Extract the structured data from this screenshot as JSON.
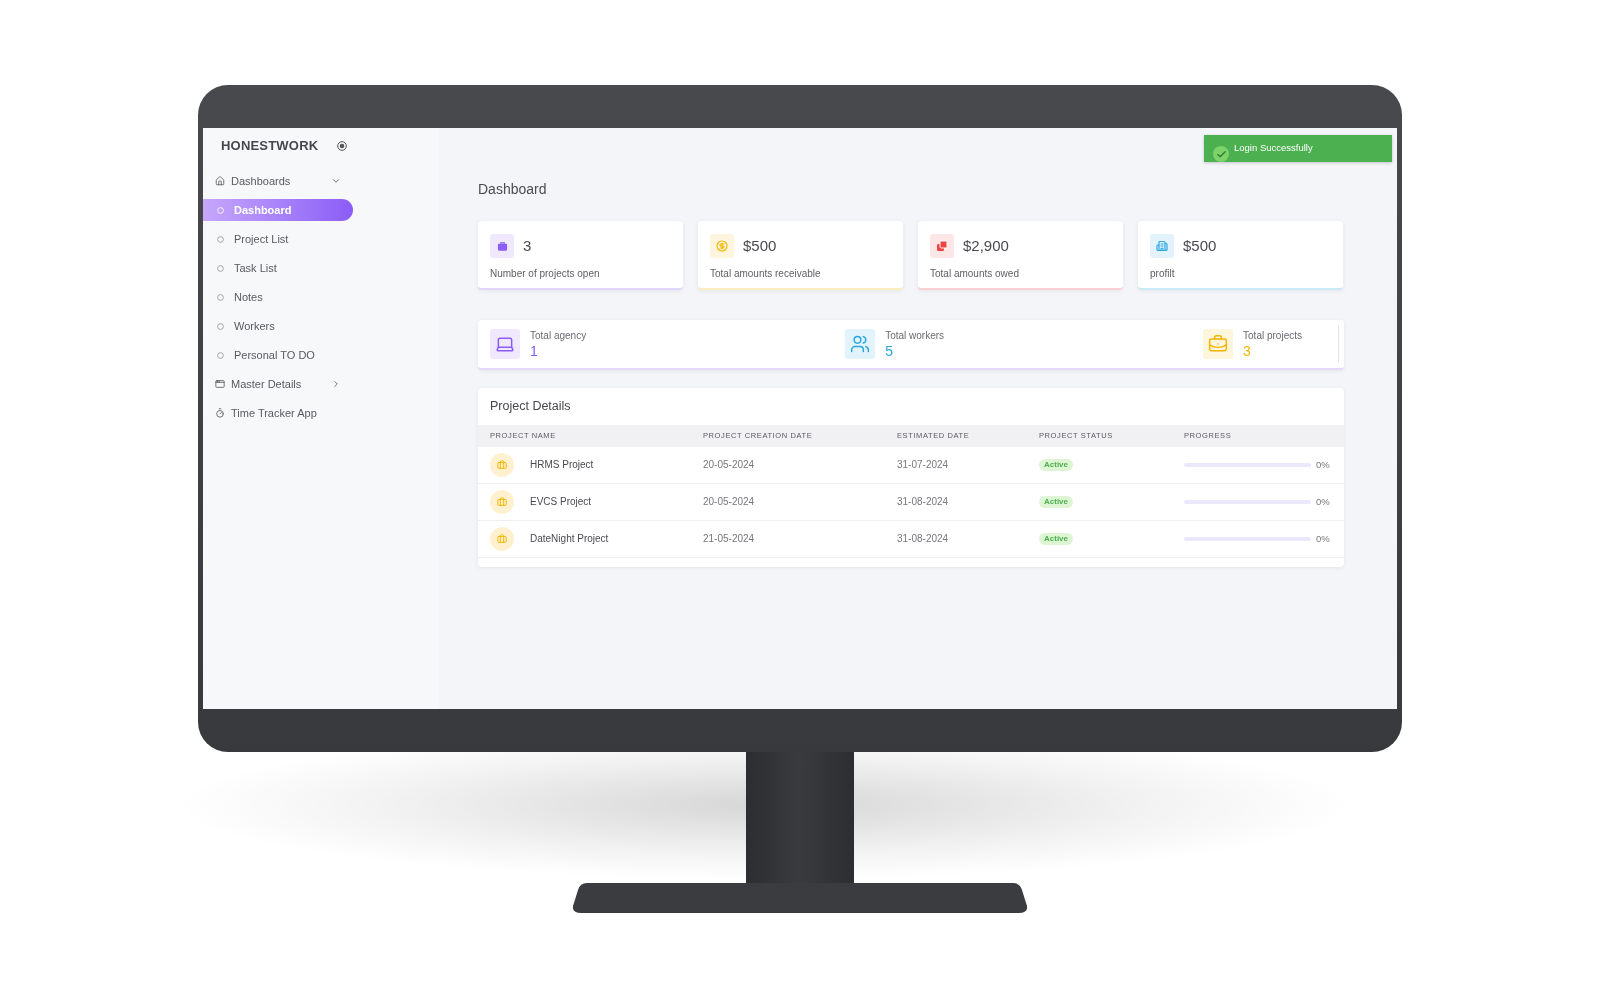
{
  "brand": {
    "name": "HONESTWORK"
  },
  "sidebar": {
    "items": [
      {
        "label": "Dashboards",
        "kind": "group",
        "expanded": true,
        "selected": false,
        "children": [
          {
            "label": "Dashboard",
            "selected": true
          },
          {
            "label": "Project List",
            "selected": false
          },
          {
            "label": "Task List",
            "selected": false
          },
          {
            "label": "Notes",
            "selected": false
          },
          {
            "label": "Workers",
            "selected": false
          },
          {
            "label": "Personal TO DO",
            "selected": false
          }
        ]
      },
      {
        "label": "Master Details",
        "kind": "group",
        "expanded": false,
        "selected": false
      },
      {
        "label": "Time Tracker App",
        "kind": "link",
        "selected": false
      }
    ]
  },
  "toast": {
    "message": "Login Successfully"
  },
  "page_title": "Dashboard",
  "summary_cards": [
    {
      "value": "3",
      "label": "Number of projects open",
      "color": "#8b5cf6"
    },
    {
      "value": "$500",
      "label": "Total amounts receivable",
      "color": "#f2b705"
    },
    {
      "value": "$2,900",
      "label": "Total amounts owed",
      "color": "#ef4444"
    },
    {
      "value": "$500",
      "label": "profilt",
      "color": "#2ea7e0"
    }
  ],
  "totals": [
    {
      "label": "Total agency",
      "value": "1",
      "color": "#8b5cf6"
    },
    {
      "label": "Total workers",
      "value": "5",
      "color": "#29a8e0"
    },
    {
      "label": "Total projects",
      "value": "3",
      "color": "#f4b400"
    }
  ],
  "project_details": {
    "title": "Project Details",
    "columns": [
      "PROJECT NAME",
      "PROJECT CREATION DATE",
      "ESTIMATED DATE",
      "PROJECT STATUS",
      "PROGRESS"
    ],
    "rows": [
      {
        "name": "HRMS Project",
        "creation_date": "20-05-2024",
        "estimated_date": "31-07-2024",
        "status": "Active",
        "level": 0,
        "progress": "0%"
      },
      {
        "name": "EVCS Project",
        "creation_date": "20-05-2024",
        "estimated_date": "31-08-2024",
        "status": "Active",
        "level": 0,
        "progress": "0%"
      },
      {
        "name": "DateNight Project",
        "creation_date": "21-05-2024",
        "estimated_date": "31-08-2024",
        "status": "Active",
        "level": 0,
        "progress": "0%"
      }
    ]
  }
}
